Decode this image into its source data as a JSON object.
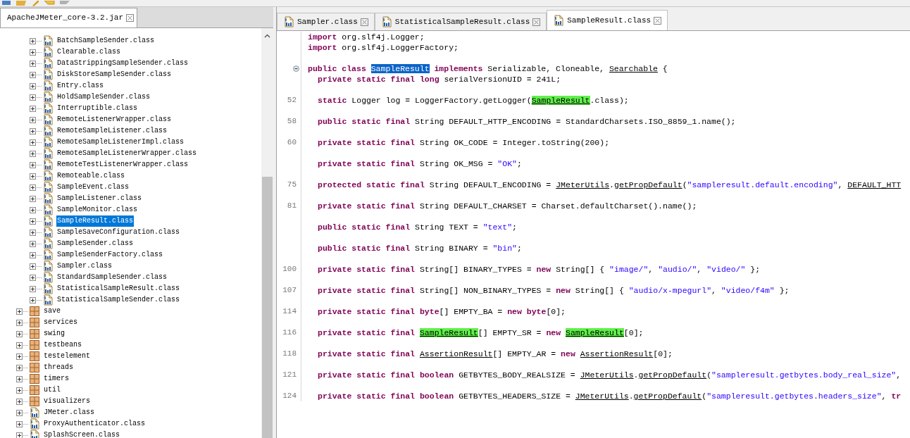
{
  "left_tab": {
    "label": "ApacheJMeter_core-3.2.jar",
    "selected": true
  },
  "tree": [
    {
      "children": [
        {
          "kind": "class",
          "label": "BatchSampleSender.class",
          "expanded": false,
          "selected": false
        },
        {
          "kind": "class",
          "label": "Clearable.class",
          "expanded": false,
          "selected": false
        },
        {
          "kind": "class",
          "label": "DataStrippingSampleSender.class",
          "expanded": false,
          "selected": false
        },
        {
          "kind": "class",
          "label": "DiskStoreSampleSender.class",
          "expanded": false,
          "selected": false
        },
        {
          "kind": "class",
          "label": "Entry.class",
          "expanded": false,
          "selected": false
        },
        {
          "kind": "class",
          "label": "HoldSampleSender.class",
          "expanded": false,
          "selected": false
        },
        {
          "kind": "class",
          "label": "Interruptible.class",
          "expanded": false,
          "selected": false
        },
        {
          "kind": "class",
          "label": "RemoteListenerWrapper.class",
          "expanded": false,
          "selected": false
        },
        {
          "kind": "class",
          "label": "RemoteSampleListener.class",
          "expanded": false,
          "selected": false
        },
        {
          "kind": "class",
          "label": "RemoteSampleListenerImpl.class",
          "expanded": false,
          "selected": false
        },
        {
          "kind": "class",
          "label": "RemoteSampleListenerWrapper.class",
          "expanded": false,
          "selected": false
        },
        {
          "kind": "class",
          "label": "RemoteTestListenerWrapper.class",
          "expanded": false,
          "selected": false
        },
        {
          "kind": "class",
          "label": "Remoteable.class",
          "expanded": false,
          "selected": false
        },
        {
          "kind": "class",
          "label": "SampleEvent.class",
          "expanded": false,
          "selected": false
        },
        {
          "kind": "class",
          "label": "SampleListener.class",
          "expanded": false,
          "selected": false
        },
        {
          "kind": "class",
          "label": "SampleMonitor.class",
          "expanded": false,
          "selected": false
        },
        {
          "kind": "class",
          "label": "SampleResult.class",
          "expanded": false,
          "selected": true
        },
        {
          "kind": "class",
          "label": "SampleSaveConfiguration.class",
          "expanded": false,
          "selected": false
        },
        {
          "kind": "class",
          "label": "SampleSender.class",
          "expanded": false,
          "selected": false
        },
        {
          "kind": "class",
          "label": "SampleSenderFactory.class",
          "expanded": false,
          "selected": false
        },
        {
          "kind": "class",
          "label": "Sampler.class",
          "expanded": false,
          "selected": false
        },
        {
          "kind": "class",
          "label": "StandardSampleSender.class",
          "expanded": false,
          "selected": false
        },
        {
          "kind": "class",
          "label": "StatisticalSampleResult.class",
          "expanded": false,
          "selected": false
        },
        {
          "kind": "class",
          "label": "StatisticalSampleSender.class",
          "expanded": false,
          "selected": false
        }
      ]
    },
    {
      "kind": "package",
      "label": "save",
      "expanded": false,
      "selected": false
    },
    {
      "kind": "package",
      "label": "services",
      "expanded": false,
      "selected": false
    },
    {
      "kind": "package",
      "label": "swing",
      "expanded": false,
      "selected": false
    },
    {
      "kind": "package",
      "label": "testbeans",
      "expanded": false,
      "selected": false
    },
    {
      "kind": "package",
      "label": "testelement",
      "expanded": false,
      "selected": false
    },
    {
      "kind": "package",
      "label": "threads",
      "expanded": false,
      "selected": false
    },
    {
      "kind": "package",
      "label": "timers",
      "expanded": false,
      "selected": false
    },
    {
      "kind": "package",
      "label": "util",
      "expanded": false,
      "selected": false
    },
    {
      "kind": "package",
      "label": "visualizers",
      "expanded": false,
      "selected": false
    },
    {
      "kind": "class",
      "label": "JMeter.class",
      "expanded": false,
      "selected": false
    },
    {
      "kind": "class",
      "label": "ProxyAuthenticator.class",
      "expanded": false,
      "selected": false
    },
    {
      "kind": "class",
      "label": "SplashScreen.class",
      "expanded": false,
      "selected": false
    }
  ],
  "editor_tabs": [
    {
      "label": "Sampler.class",
      "selected": false
    },
    {
      "label": "StatisticalSampleResult.class",
      "selected": false
    },
    {
      "label": "SampleResult.class",
      "selected": true
    }
  ],
  "code": [
    {
      "spaced": false,
      "tokens": [
        {
          "kind": "kw",
          "text": "import"
        },
        {
          "kind": "plain",
          "text": " org.slf4j.Logger;"
        }
      ]
    },
    {
      "spaced": false,
      "tokens": [
        {
          "kind": "kw",
          "text": "import"
        },
        {
          "kind": "plain",
          "text": " org.slf4j.LoggerFactory;"
        }
      ]
    },
    {
      "spaced": true,
      "foldable": true,
      "tokens": [
        {
          "kind": "kw",
          "text": "public class "
        },
        {
          "kind": "sel",
          "text": "SampleResult"
        },
        {
          "kind": "kw",
          "text": " implements"
        },
        {
          "kind": "plain",
          "text": " Serializable, Cloneable, "
        },
        {
          "kind": "link",
          "text": "Searchable"
        },
        {
          "kind": "plain",
          "text": " {"
        }
      ],
      "children": [
        {
          "spaced": false,
          "tokens": [
            {
              "kind": "kw",
              "text": "private static final long"
            },
            {
              "kind": "plain",
              "text": " serialVersionUID = 241L;"
            }
          ]
        },
        {
          "spaced": true,
          "number": "52",
          "tokens": [
            {
              "kind": "kw",
              "text": "static"
            },
            {
              "kind": "plain",
              "text": " Logger log = LoggerFactory.getLogger("
            },
            {
              "kind": "mark",
              "text": "SampleResult"
            },
            {
              "kind": "plain",
              "text": ".class);"
            }
          ]
        },
        {
          "spaced": true,
          "number": "58",
          "tokens": [
            {
              "kind": "kw",
              "text": "public static final"
            },
            {
              "kind": "plain",
              "text": " String DEFAULT_HTTP_ENCODING = StandardCharsets.ISO_8859_1.name();"
            }
          ]
        },
        {
          "spaced": true,
          "number": "60",
          "tokens": [
            {
              "kind": "kw",
              "text": "private static final"
            },
            {
              "kind": "plain",
              "text": " String OK_CODE = Integer.toString(200);"
            }
          ]
        },
        {
          "spaced": true,
          "tokens": [
            {
              "kind": "kw",
              "text": "private static final"
            },
            {
              "kind": "plain",
              "text": " String OK_MSG = "
            },
            {
              "kind": "str",
              "text": "\"OK\""
            },
            {
              "kind": "plain",
              "text": ";"
            }
          ]
        },
        {
          "spaced": true,
          "number": "75",
          "tokens": [
            {
              "kind": "kw",
              "text": "protected static final"
            },
            {
              "kind": "plain",
              "text": " String DEFAULT_ENCODING = "
            },
            {
              "kind": "link",
              "text": "JMeterUtils"
            },
            {
              "kind": "plain",
              "text": "."
            },
            {
              "kind": "link",
              "text": "getPropDefault"
            },
            {
              "kind": "plain",
              "text": "("
            },
            {
              "kind": "str",
              "text": "\"sampleresult.default.encoding\""
            },
            {
              "kind": "plain",
              "text": ", "
            },
            {
              "kind": "link",
              "text": "DEFAULT_HTT"
            }
          ]
        },
        {
          "spaced": true,
          "number": "81",
          "tokens": [
            {
              "kind": "kw",
              "text": "private static final"
            },
            {
              "kind": "plain",
              "text": " String DEFAULT_CHARSET = Charset.defaultCharset().name();"
            }
          ]
        },
        {
          "spaced": true,
          "tokens": [
            {
              "kind": "kw",
              "text": "public static final"
            },
            {
              "kind": "plain",
              "text": " String TEXT = "
            },
            {
              "kind": "str",
              "text": "\"text\""
            },
            {
              "kind": "plain",
              "text": ";"
            }
          ]
        },
        {
          "spaced": true,
          "tokens": [
            {
              "kind": "kw",
              "text": "public static final"
            },
            {
              "kind": "plain",
              "text": " String BINARY = "
            },
            {
              "kind": "str",
              "text": "\"bin\""
            },
            {
              "kind": "plain",
              "text": ";"
            }
          ]
        },
        {
          "spaced": true,
          "number": "100",
          "tokens": [
            {
              "kind": "kw",
              "text": "private static final"
            },
            {
              "kind": "plain",
              "text": " String[] BINARY_TYPES = "
            },
            {
              "kind": "kw",
              "text": "new"
            },
            {
              "kind": "plain",
              "text": " String[] { "
            },
            {
              "kind": "str",
              "text": "\"image/\""
            },
            {
              "kind": "plain",
              "text": ", "
            },
            {
              "kind": "str",
              "text": "\"audio/\""
            },
            {
              "kind": "plain",
              "text": ", "
            },
            {
              "kind": "str",
              "text": "\"video/\""
            },
            {
              "kind": "plain",
              "text": " };"
            }
          ]
        },
        {
          "spaced": true,
          "number": "107",
          "tokens": [
            {
              "kind": "kw",
              "text": "private static final"
            },
            {
              "kind": "plain",
              "text": " String[] NON_BINARY_TYPES = "
            },
            {
              "kind": "kw",
              "text": "new"
            },
            {
              "kind": "plain",
              "text": " String[] { "
            },
            {
              "kind": "str",
              "text": "\"audio/x-mpegurl\""
            },
            {
              "kind": "plain",
              "text": ", "
            },
            {
              "kind": "str",
              "text": "\"video/f4m\""
            },
            {
              "kind": "plain",
              "text": " };"
            }
          ]
        },
        {
          "spaced": true,
          "number": "114",
          "tokens": [
            {
              "kind": "kw",
              "text": "private static final byte"
            },
            {
              "kind": "plain",
              "text": "[] EMPTY_BA = "
            },
            {
              "kind": "kw",
              "text": "new byte"
            },
            {
              "kind": "plain",
              "text": "[0];"
            }
          ]
        },
        {
          "spaced": true,
          "number": "116",
          "tokens": [
            {
              "kind": "kw",
              "text": "private static final "
            },
            {
              "kind": "mark",
              "text": "SampleResult"
            },
            {
              "kind": "plain",
              "text": "[] EMPTY_SR = "
            },
            {
              "kind": "kw",
              "text": "new "
            },
            {
              "kind": "mark",
              "text": "SampleResult"
            },
            {
              "kind": "plain",
              "text": "[0];"
            }
          ]
        },
        {
          "spaced": true,
          "number": "118",
          "tokens": [
            {
              "kind": "kw",
              "text": "private static final "
            },
            {
              "kind": "link",
              "text": "AssertionResult"
            },
            {
              "kind": "plain",
              "text": "[] EMPTY_AR = "
            },
            {
              "kind": "kw",
              "text": "new "
            },
            {
              "kind": "link",
              "text": "AssertionResult"
            },
            {
              "kind": "plain",
              "text": "[0];"
            }
          ]
        },
        {
          "spaced": true,
          "number": "121",
          "tokens": [
            {
              "kind": "kw",
              "text": "private static final boolean"
            },
            {
              "kind": "plain",
              "text": " GETBYTES_BODY_REALSIZE = "
            },
            {
              "kind": "link",
              "text": "JMeterUtils"
            },
            {
              "kind": "plain",
              "text": "."
            },
            {
              "kind": "link",
              "text": "getPropDefault"
            },
            {
              "kind": "plain",
              "text": "("
            },
            {
              "kind": "str",
              "text": "\"sampleresult.getbytes.body_real_size\""
            },
            {
              "kind": "plain",
              "text": ","
            }
          ]
        },
        {
          "spaced": true,
          "number": "124",
          "tokens": [
            {
              "kind": "kw",
              "text": "private static final boolean"
            },
            {
              "kind": "plain",
              "text": " GETBYTES_HEADERS_SIZE = "
            },
            {
              "kind": "link",
              "text": "JMeterUtils"
            },
            {
              "kind": "plain",
              "text": "."
            },
            {
              "kind": "link",
              "text": "getPropDefault"
            },
            {
              "kind": "plain",
              "text": "("
            },
            {
              "kind": "str",
              "text": "\"sampleresult.getbytes.headers_size\""
            },
            {
              "kind": "plain",
              "text": ", "
            },
            {
              "kind": "kw",
              "text": "tr"
            }
          ]
        }
      ]
    }
  ]
}
